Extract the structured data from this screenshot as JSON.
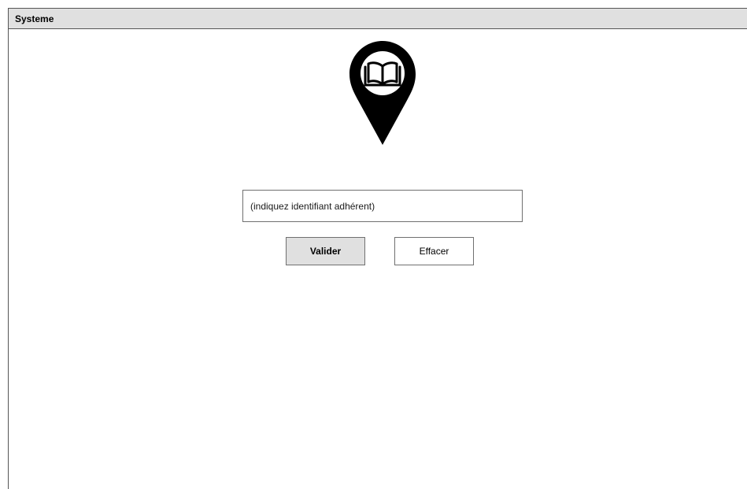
{
  "window": {
    "title": "Systeme"
  },
  "logo": {
    "icon": "book-location-pin-icon"
  },
  "form": {
    "id_input": {
      "placeholder": "(indiquez identifiant adhérent)",
      "value": ""
    },
    "validate_label": "Valider",
    "clear_label": "Effacer"
  },
  "colors": {
    "titlebar_bg": "#e0e0e0",
    "border": "#707070",
    "pin": "#000000"
  }
}
